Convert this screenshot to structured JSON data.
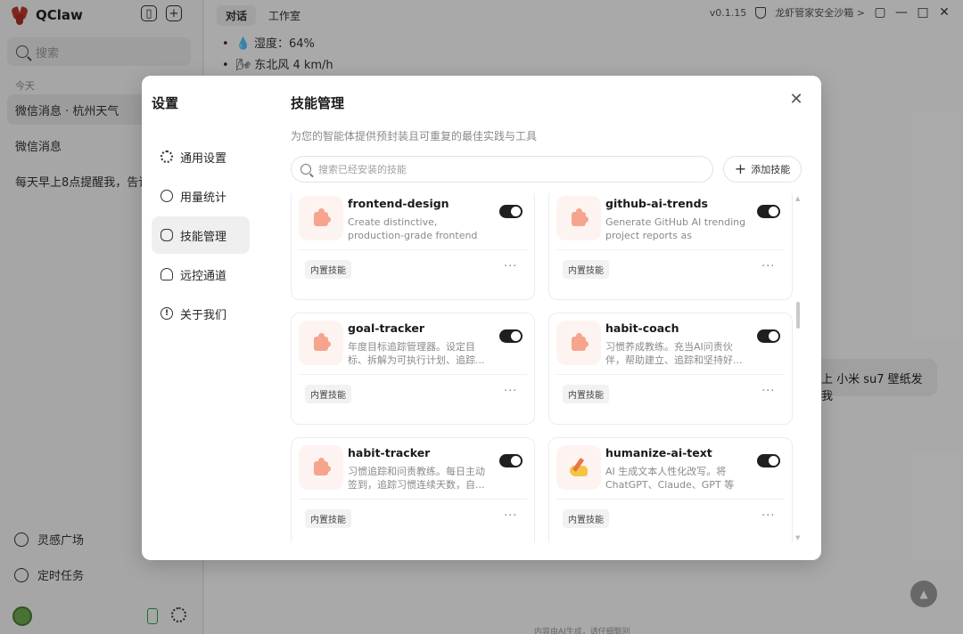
{
  "app": {
    "name": "QClaw",
    "search_placeholder": "搜索",
    "section_today": "今天",
    "chats": [
      {
        "label": "微信消息 · 杭州天气"
      },
      {
        "label": "微信消息"
      },
      {
        "label": "每天早上8点提醒我，告诉"
      }
    ],
    "bottom_nav": [
      {
        "label": "灵感广场"
      },
      {
        "label": "定时任务"
      }
    ]
  },
  "main": {
    "tabs": [
      {
        "label": "对话"
      },
      {
        "label": "工作室"
      }
    ],
    "version": "v0.1.15",
    "sandbox_label": "龙虾管家安全沙箱 >",
    "weather_lines": [
      {
        "text": "💧 湿度：64%"
      },
      {
        "text": "🌬 东北风 4 km/h"
      }
    ],
    "user_bubble": "上 小米 su7 壁纸发我",
    "footer_note": "内容由AI生成，请仔细甄别"
  },
  "settings": {
    "title": "设置",
    "nav": [
      {
        "label": "通用设置",
        "icon": "gear-icon"
      },
      {
        "label": "用量统计",
        "icon": "chart-icon"
      },
      {
        "label": "技能管理",
        "icon": "brain-icon"
      },
      {
        "label": "远控通道",
        "icon": "remote-icon"
      },
      {
        "label": "关于我们",
        "icon": "info-icon"
      }
    ],
    "active_nav": "技能管理",
    "content_title": "技能管理",
    "content_subtitle": "为您的智能体提供预封装且可重复的最佳实践与工具",
    "search_placeholder": "搜索已经安装的技能",
    "add_button": "添加技能",
    "more_glyph": "···",
    "skills": [
      {
        "name": "frontend-design",
        "desc": "Create distinctive, production-grade frontend interfaces wi...",
        "tag": "内置技能",
        "enabled": true,
        "icon": "puzzle-icon"
      },
      {
        "name": "github-ai-trends",
        "desc": "Generate GitHub AI trending project reports as formatted...",
        "tag": "内置技能",
        "enabled": true,
        "icon": "puzzle-icon"
      },
      {
        "name": "goal-tracker",
        "desc": "年度目标追踪管理器。设定目标、拆解为可执行计划、追踪...",
        "tag": "内置技能",
        "enabled": true,
        "icon": "puzzle-icon"
      },
      {
        "name": "habit-coach",
        "desc": "习惯养成教练。充当AI问责伙伴，帮助建立、追踪和坚持好...",
        "tag": "内置技能",
        "enabled": true,
        "icon": "puzzle-icon"
      },
      {
        "name": "habit-tracker",
        "desc": "习惯追踪和问责教练。每日主动签到，追踪习惯连续天数，自...",
        "tag": "内置技能",
        "enabled": true,
        "icon": "puzzle-icon"
      },
      {
        "name": "humanize-ai-text",
        "desc": "AI 生成文本人性化改写。将 ChatGPT、Claude、GPT 等生...",
        "tag": "内置技能",
        "enabled": true,
        "icon": "writing-hand-icon"
      }
    ]
  }
}
